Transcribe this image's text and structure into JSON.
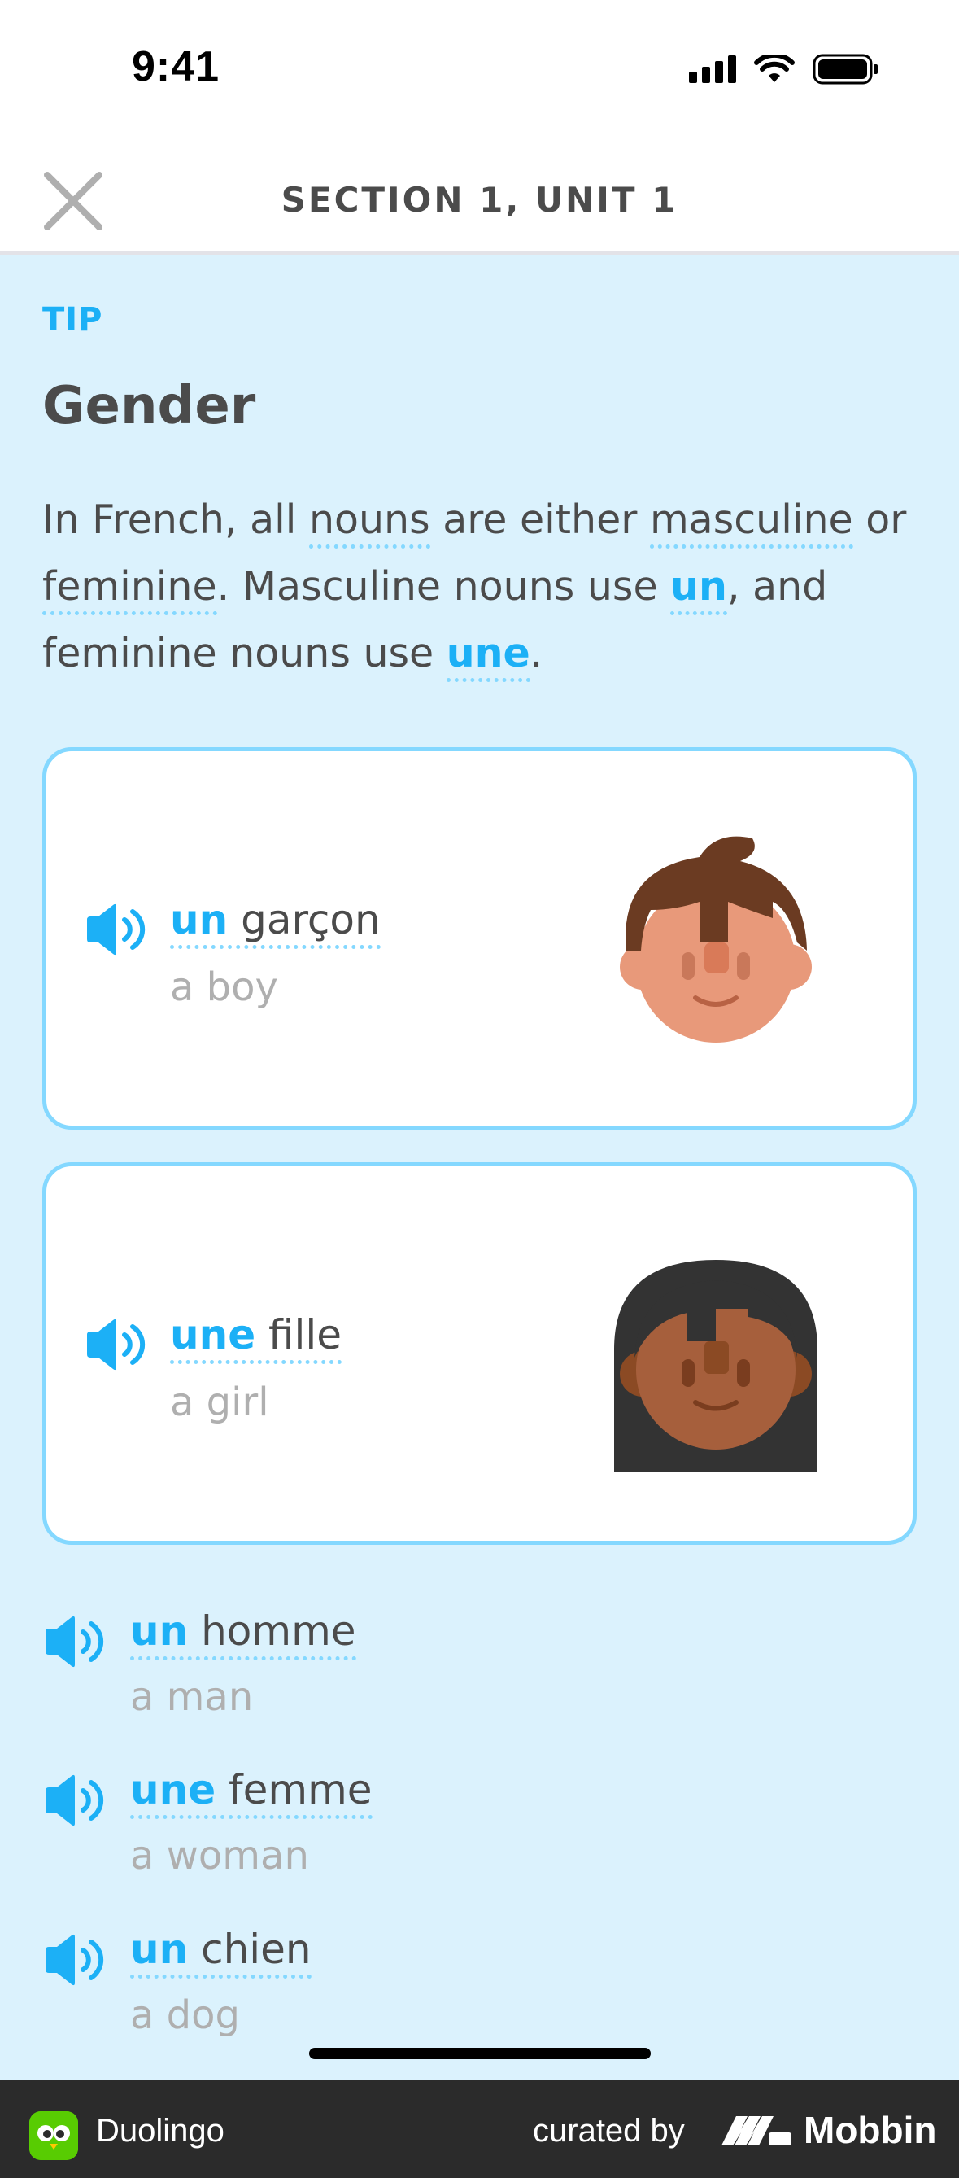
{
  "status_bar": {
    "time": "9:41"
  },
  "header": {
    "title": "SECTION 1, UNIT 1"
  },
  "tip": {
    "label": "TIP",
    "title": "Gender",
    "intro": {
      "t1": "In French, all ",
      "nouns": "nouns",
      "t2": " are either ",
      "masculine": "masculine",
      "t3": " or ",
      "feminine": "feminine",
      "t4": ". Masculine nouns use ",
      "un": "un",
      "t5": ", and feminine nouns use ",
      "une": "une",
      "t6": "."
    }
  },
  "cards": [
    {
      "article": "un",
      "noun": " garçon",
      "translation": "a boy",
      "avatar": "boy-avatar"
    },
    {
      "article": "une",
      "noun": " fille",
      "translation": "a girl",
      "avatar": "girl-avatar"
    }
  ],
  "items": [
    {
      "article": "un",
      "noun": " homme",
      "translation": "a man"
    },
    {
      "article": "une",
      "noun": " femme",
      "translation": "a woman"
    },
    {
      "article": "un",
      "noun": " chien",
      "translation": "a dog"
    }
  ],
  "footer": {
    "app_name": "Duolingo",
    "curated_by": "curated by",
    "brand": "Mobbin"
  },
  "colors": {
    "accent": "#1cb0f6",
    "card_border": "#84d8ff",
    "background": "#dbf2fd",
    "text": "#4b4b4b",
    "muted": "#afafaf"
  },
  "icons": [
    "signal-icon",
    "wifi-icon",
    "battery-icon",
    "close-icon",
    "speaker-icon",
    "duolingo-logo",
    "mobbin-logo"
  ]
}
